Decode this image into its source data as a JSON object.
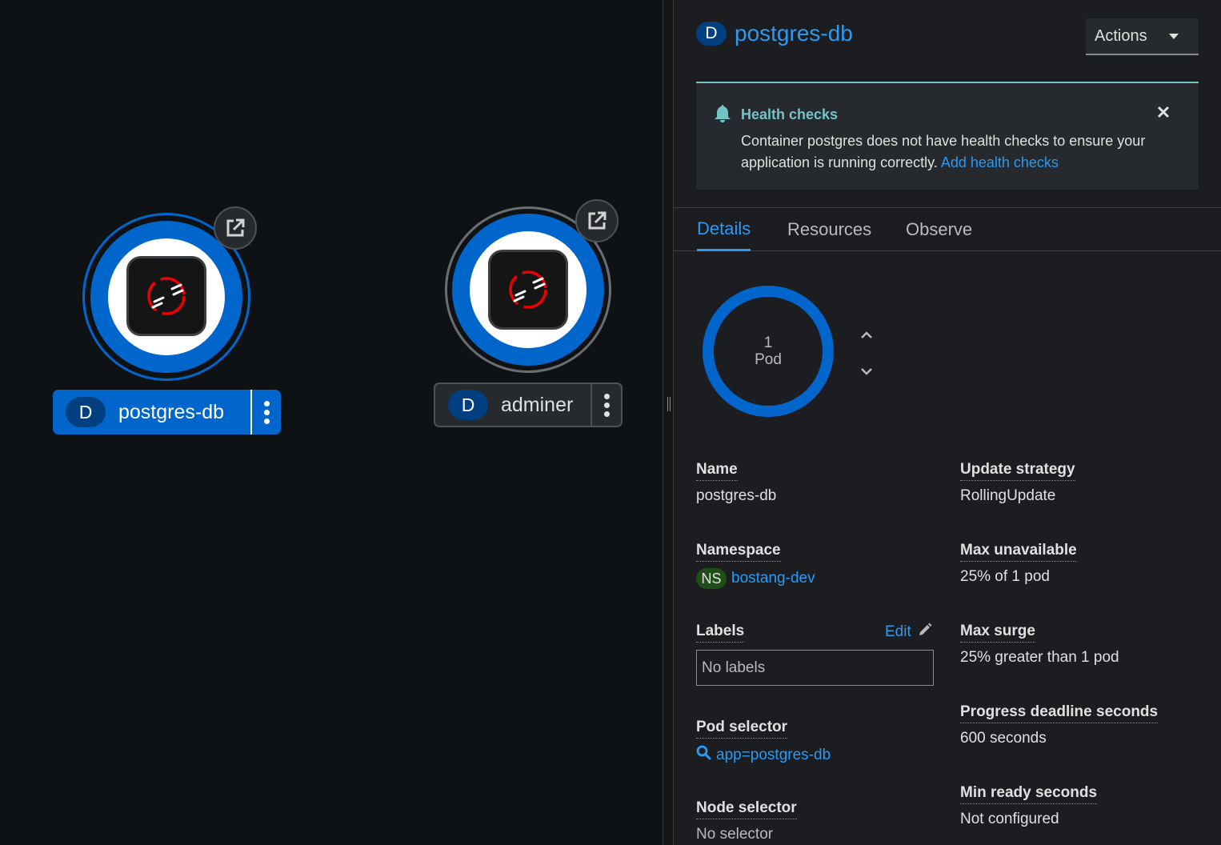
{
  "topology": {
    "nodes": [
      {
        "badge": "D",
        "name": "postgres-db",
        "selected": true
      },
      {
        "badge": "D",
        "name": "adminer",
        "selected": false
      }
    ]
  },
  "panel": {
    "title_badge": "D",
    "title": "postgres-db",
    "actions_label": "Actions",
    "alert": {
      "title": "Health checks",
      "body": "Container postgres does not have health checks to ensure your application is running correctly.",
      "link": "Add health checks"
    },
    "tabs": [
      "Details",
      "Resources",
      "Observe"
    ],
    "active_tab": "Details",
    "pods": {
      "count": "1",
      "unit": "Pod"
    },
    "details": {
      "name_label": "Name",
      "name_value": "postgres-db",
      "namespace_label": "Namespace",
      "namespace_badge": "NS",
      "namespace_value": "bostang-dev",
      "labels_label": "Labels",
      "labels_edit": "Edit",
      "labels_value": "No labels",
      "pod_selector_label": "Pod selector",
      "pod_selector_value": "app=postgres-db",
      "node_selector_label": "Node selector",
      "node_selector_value": "No selector",
      "update_strategy_label": "Update strategy",
      "update_strategy_value": "RollingUpdate",
      "max_unavailable_label": "Max unavailable",
      "max_unavailable_value": "25% of 1 pod",
      "max_surge_label": "Max surge",
      "max_surge_value": "25% greater than 1 pod",
      "progress_deadline_label": "Progress deadline seconds",
      "progress_deadline_value": "600 seconds",
      "min_ready_label": "Min ready seconds",
      "min_ready_value": "Not configured"
    }
  },
  "colors": {
    "accent": "#0066cc",
    "link": "#2b9af3",
    "alert": "#73c5c5"
  }
}
